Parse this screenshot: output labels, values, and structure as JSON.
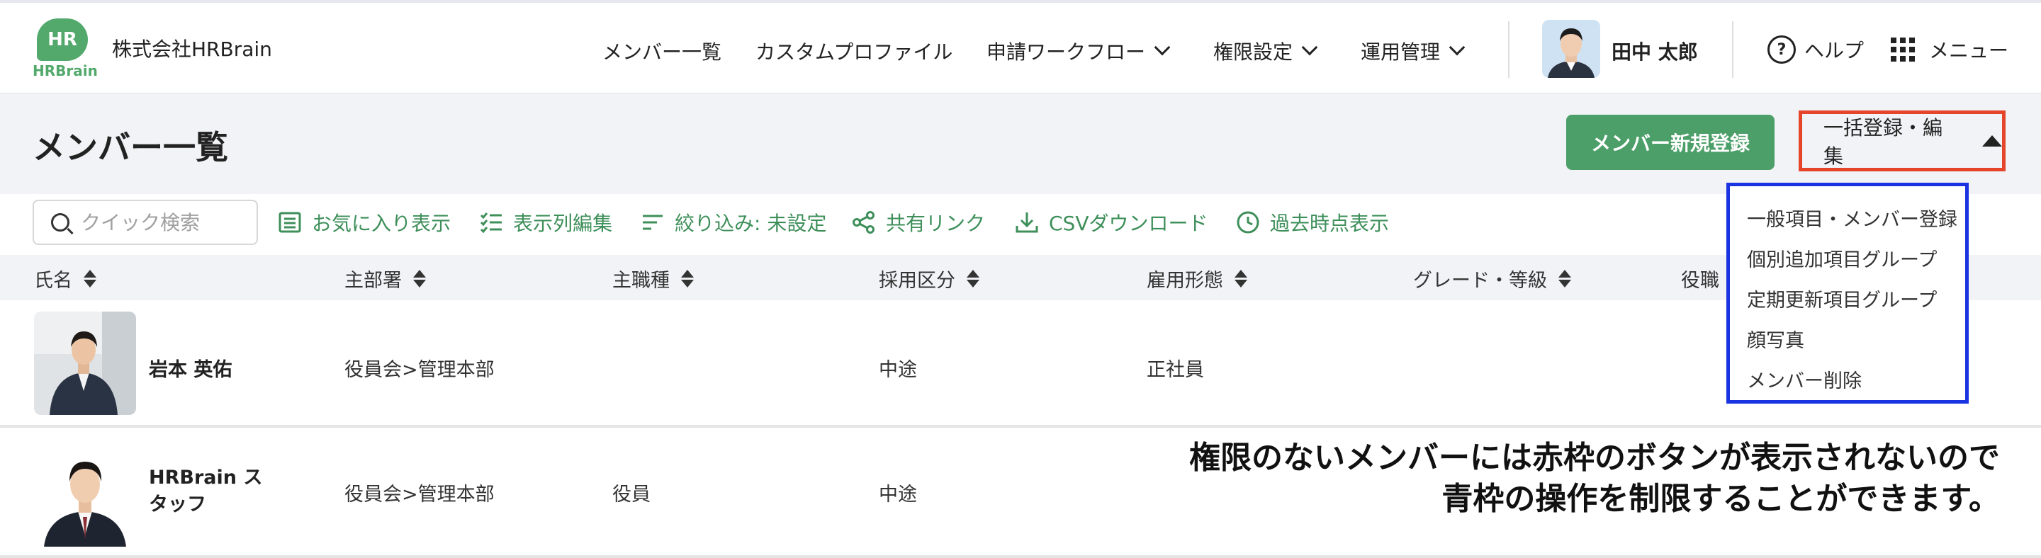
{
  "brand": {
    "logo_mark": "HR",
    "logo_text": "HRBrain",
    "company": "株式会社HRBrain",
    "color": "#52a96b"
  },
  "nav": {
    "items": [
      {
        "label": "メンバー一覧",
        "dropdown": false
      },
      {
        "label": "カスタムプロファイル",
        "dropdown": false
      },
      {
        "label": "申請ワークフロー",
        "dropdown": true
      },
      {
        "label": "権限設定",
        "dropdown": true
      },
      {
        "label": "運用管理",
        "dropdown": true
      }
    ],
    "user_name": "田中 太郎",
    "help": "ヘルプ",
    "menu": "メニュー"
  },
  "page": {
    "title": "メンバー一覧",
    "new_member_button": "メンバー新規登録",
    "bulk_button": "一括登録・編集"
  },
  "toolbar": {
    "search_placeholder": "クイック検索",
    "favorites": "お気に入り表示",
    "columns": "表示列編集",
    "filter": "絞り込み: 未設定",
    "share": "共有リンク",
    "csv": "CSVダウンロード",
    "past": "過去時点表示"
  },
  "table": {
    "columns": [
      "氏名",
      "主部署",
      "主職種",
      "採用区分",
      "雇用形態",
      "グレード・等級",
      "役職"
    ],
    "rows": [
      {
        "name": "岩本 英佑",
        "department": "役員会>管理本部",
        "job": "",
        "hiring": "中途",
        "employment": "正社員"
      },
      {
        "name_line1": "HRBrain ス",
        "name_line2": "タッフ",
        "department": "役員会>管理本部",
        "job": "役員",
        "hiring": "中途"
      }
    ]
  },
  "dropdown": {
    "items": [
      "一般項目・メンバー登録",
      "個別追加項目グループ",
      "定期更新項目グループ",
      "顔写真",
      "メンバー削除"
    ]
  },
  "annotation": {
    "line1": "権限のないメンバーには赤枠のボタンが表示されないので",
    "line2": "青枠の操作を制限することができます。"
  },
  "colors": {
    "accent_green": "#4d9f69",
    "highlight_red": "#e5462b",
    "highlight_blue": "#1a33e0"
  }
}
